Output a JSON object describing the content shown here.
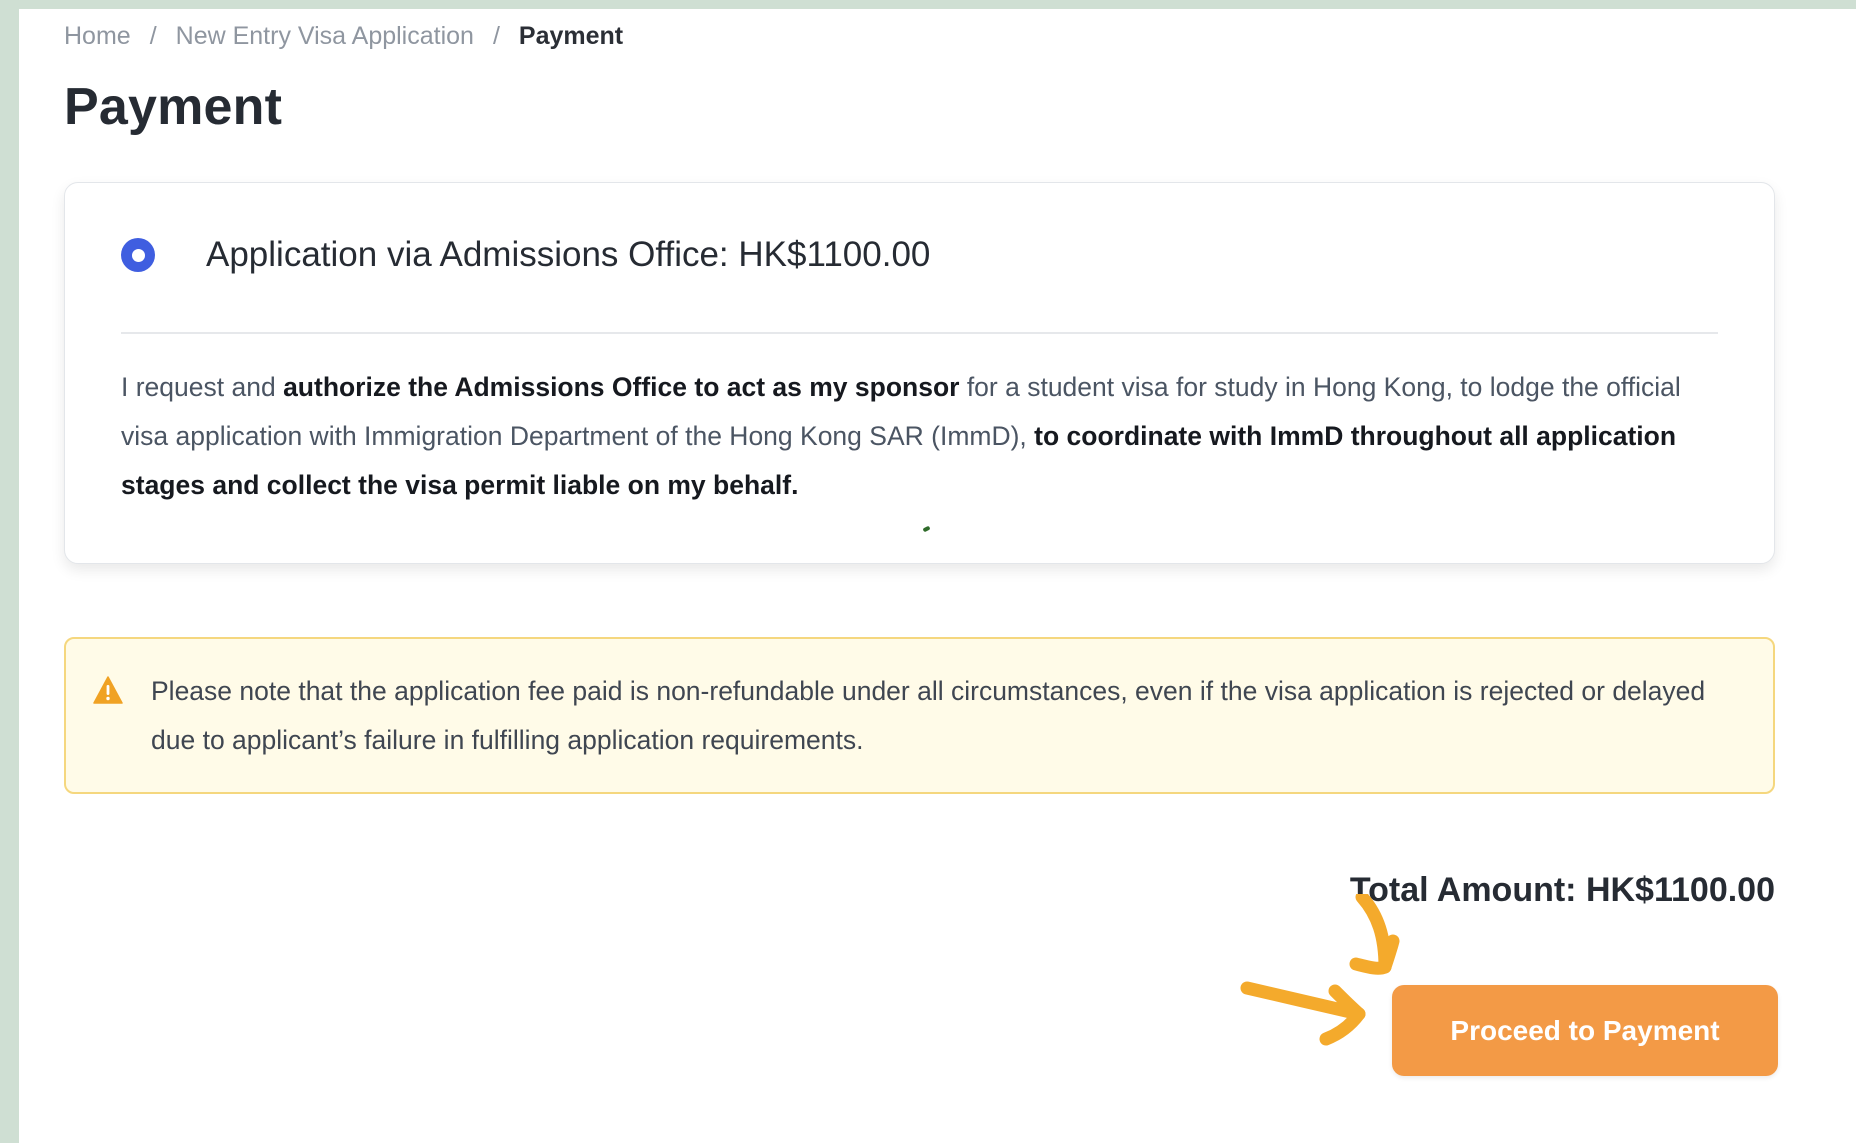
{
  "breadcrumb": {
    "items": [
      "Home",
      "New Entry Visa Application",
      "Payment"
    ],
    "separator": "/"
  },
  "page_title": "Payment",
  "option": {
    "selected": true,
    "title": "Application via Admissions Office: HK$1100.00",
    "description": {
      "part1": "I request and ",
      "bold1": "authorize the Admissions Office to act as my sponsor",
      "part2": " for a student visa for study in Hong Kong, to lodge the official visa application with Immigration Department of the Hong Kong SAR (ImmD), ",
      "bold2": "to coordinate with ImmD throughout all application stages and collect the visa permit liable on my behalf."
    }
  },
  "notice": {
    "icon": "warning-icon",
    "text": "Please note that the application fee paid is non-refundable under all circumstances, even if the visa application is rejected or delayed due to applicant’s failure in fulfilling application requirements."
  },
  "total": "Total Amount: HK$1100.00",
  "proceed_button": "Proceed to Payment",
  "colors": {
    "accent": "#3f5ee0",
    "button": "#f39a46",
    "annotation_arrows": "#f4aa2c",
    "notice_bg": "#fffbe8",
    "notice_border": "#f5d77e",
    "warning": "#f0a224"
  }
}
